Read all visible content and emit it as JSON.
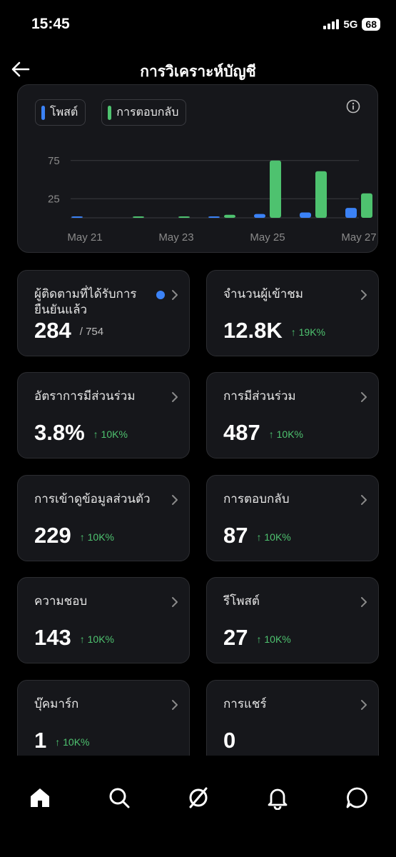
{
  "status": {
    "time": "15:45",
    "network": "5G",
    "battery": "68"
  },
  "header": {
    "title": "การวิเคราะห์บัญชี"
  },
  "chart": {
    "legend": [
      {
        "label": "โพสต์",
        "color": "#3b82f6"
      },
      {
        "label": "การตอบกลับ",
        "color": "#4ec26f"
      }
    ]
  },
  "chart_data": {
    "type": "bar",
    "categories": [
      "May 21",
      "May 22",
      "May 23",
      "May 24",
      "May 25",
      "May 26",
      "May 27"
    ],
    "xticks": [
      "May 21",
      "May 23",
      "May 25",
      "May 27"
    ],
    "yticks": [
      "75",
      "25"
    ],
    "ylim": [
      0,
      100
    ],
    "series": [
      {
        "name": "โพสต์",
        "color": "#3b82f6",
        "values": [
          1,
          0,
          0,
          1,
          5,
          7,
          13
        ]
      },
      {
        "name": "การตอบกลับ",
        "color": "#4ec26f",
        "values": [
          0,
          1,
          1,
          4,
          75,
          61,
          32
        ]
      }
    ]
  },
  "cards": [
    {
      "label": "ผู้ติดตามที่ได้รับการยืนยันแล้ว",
      "value": "284",
      "extra": "/ 754"
    },
    {
      "label": "จำนวนผู้เข้าชม",
      "value": "12.8K",
      "change": "↑ 19K%"
    },
    {
      "label": "อัตราการมีส่วนร่วม",
      "value": "3.8%",
      "change": "↑ 10K%"
    },
    {
      "label": "การมีส่วนร่วม",
      "value": "487",
      "change": "↑ 10K%"
    },
    {
      "label": "การเข้าดูข้อมูลส่วนตัว",
      "value": "229",
      "change": "↑ 10K%"
    },
    {
      "label": "การตอบกลับ",
      "value": "87",
      "change": "↑ 10K%"
    },
    {
      "label": "ความชอบ",
      "value": "143",
      "change": "↑ 10K%"
    },
    {
      "label": "รีโพสต์",
      "value": "27",
      "change": "↑ 10K%"
    },
    {
      "label": "บุ๊คมาร์ก",
      "value": "1",
      "change": "↑ 10K%"
    },
    {
      "label": "การแชร์",
      "value": "0"
    }
  ],
  "nav": [
    "home-icon",
    "search-icon",
    "feed-icon",
    "notifications-icon",
    "messages-icon"
  ]
}
